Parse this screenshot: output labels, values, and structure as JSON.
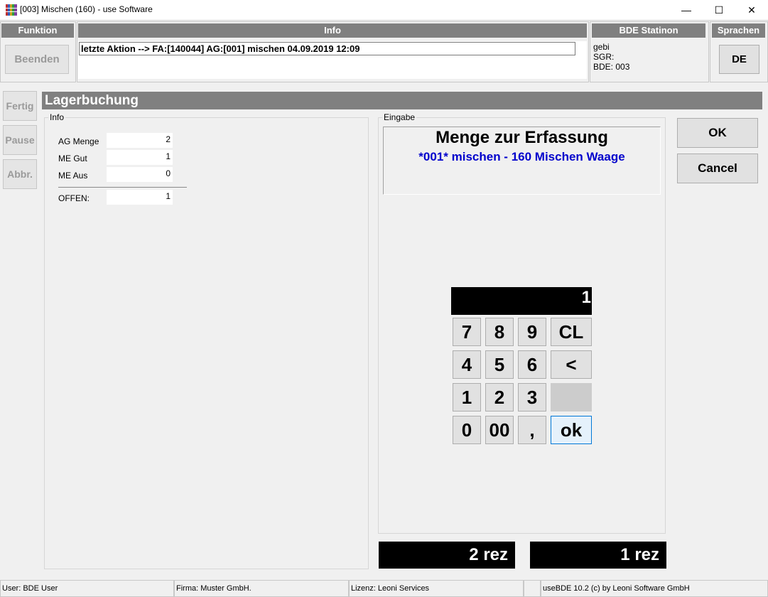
{
  "window": {
    "title": "[003] Mischen (160) - use Software",
    "minimize_glyph": "—",
    "maximize_glyph": "☐",
    "close_glyph": "✕"
  },
  "header": {
    "funktion_title": "Funktion",
    "beenden_label": "Beenden",
    "info_title": "Info",
    "info_text": "letzte Aktion --> FA:[140044] AG:[001] mischen 04.09.2019 12:09",
    "station_title": "BDE Statinon",
    "station_lines": [
      "gebi",
      "SGR:",
      "BDE: 003"
    ],
    "sprachen_title": "Sprachen",
    "language_button": "DE"
  },
  "side_buttons": [
    "Fertig",
    "Pause",
    "Abbr."
  ],
  "section_title": "Lagerbuchung",
  "info_group": {
    "legend": "Info",
    "rows": [
      {
        "label": "AG Menge",
        "value": "2"
      },
      {
        "label": "ME Gut",
        "value": "1"
      },
      {
        "label": "ME Aus",
        "value": "0"
      }
    ],
    "total": {
      "label": "OFFEN:",
      "value": "1"
    }
  },
  "input_group": {
    "legend": "Eingabe",
    "heading": "Menge zur Erfassung",
    "subheading": "*001* mischen - 160 Mischen Waage",
    "display_value": "1",
    "keys": [
      [
        "7",
        "8",
        "9",
        "CL"
      ],
      [
        "4",
        "5",
        "6",
        "<"
      ],
      [
        "1",
        "2",
        "3",
        ""
      ],
      [
        "0",
        "00",
        ",",
        "ok"
      ]
    ],
    "counter_left": "2 rez",
    "counter_right": "1 rez"
  },
  "actions": {
    "ok_label": "OK",
    "cancel_label": "Cancel"
  },
  "statusbar": {
    "user": "User: BDE User",
    "firma": "Firma: Muster GmbH.",
    "lizenz": "Lizenz: Leoni Services",
    "empty": "",
    "version": "useBDE 10.2 (c) by Leoni Software GmbH"
  },
  "colors": {
    "header_gray": "#808080",
    "subheading_blue": "#0000cc",
    "ok_key_bg": "#e5f1fb",
    "ok_key_border": "#0078d7"
  }
}
